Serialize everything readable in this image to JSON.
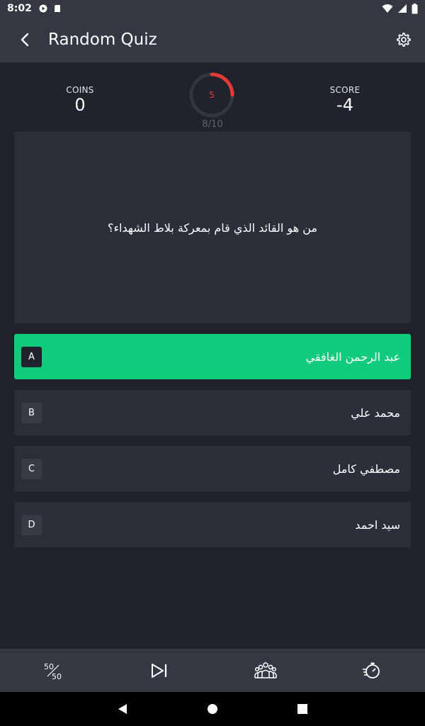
{
  "status_bar": {
    "time": "8:02"
  },
  "app_bar": {
    "title": "Random Quiz"
  },
  "stats": {
    "coins_label": "COINS",
    "coins_value": "0",
    "score_label": "SCORE",
    "score_value": "-4"
  },
  "timer": {
    "seconds_left": "5",
    "fraction_remaining": 0.25,
    "color": "#e53935"
  },
  "progress": {
    "text": "8/10"
  },
  "question": {
    "text": "من هو القائد الذي قام بمعركة بلاط الشهداء؟"
  },
  "options": [
    {
      "letter": "A",
      "text": "عبد الرحمن الغافقي",
      "selected": true
    },
    {
      "letter": "B",
      "text": "محمد علي",
      "selected": false
    },
    {
      "letter": "C",
      "text": "مصطفي كامل",
      "selected": false
    },
    {
      "letter": "D",
      "text": "سيد احمد",
      "selected": false
    }
  ],
  "lifelines": [
    {
      "icon": "fifty-fifty-icon"
    },
    {
      "icon": "skip-icon"
    },
    {
      "icon": "audience-poll-icon"
    },
    {
      "icon": "timer-reset-icon"
    }
  ],
  "colors": {
    "background": "#21232c",
    "bar": "#333843",
    "card": "#2c2f39",
    "correct": "#0fcb7b"
  }
}
